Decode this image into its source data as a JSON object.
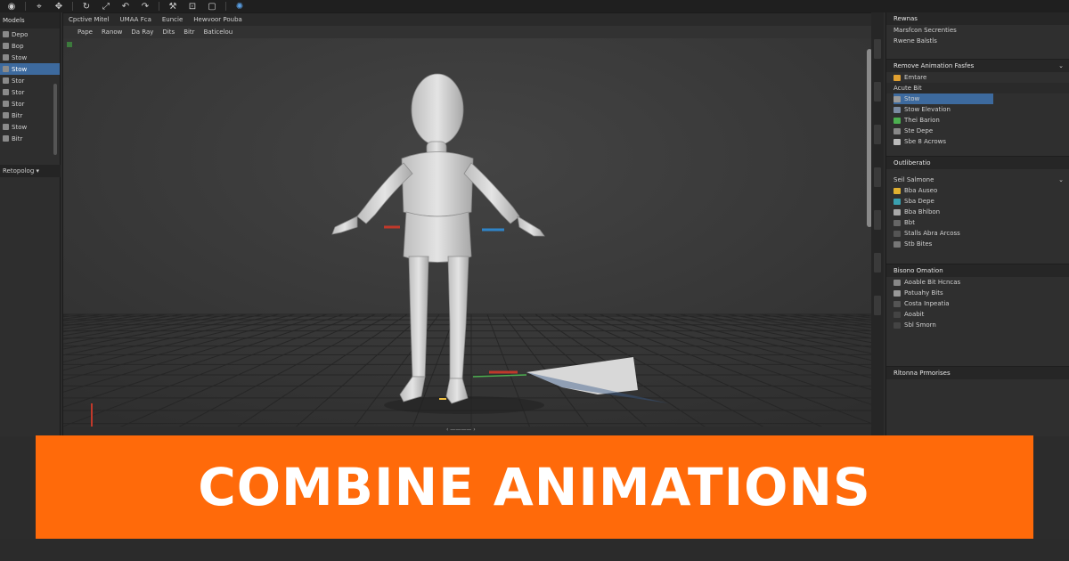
{
  "toolbar": {
    "icons": [
      "viewport-icon",
      "select-icon",
      "move-icon",
      "rotate-icon",
      "scale-icon",
      "undo-icon",
      "redo-icon",
      "transform-icon",
      "snap-icon",
      "frame-icon",
      "globe-icon"
    ]
  },
  "left_panel": {
    "header": "Models",
    "items": [
      {
        "label": "Depo",
        "selected": false
      },
      {
        "label": "Bop",
        "selected": false
      },
      {
        "label": "Stow",
        "selected": false
      },
      {
        "label": "Stow",
        "selected": true
      },
      {
        "label": "Stor",
        "selected": false
      },
      {
        "label": "Stor",
        "selected": false
      },
      {
        "label": "Stor",
        "selected": false
      },
      {
        "label": "Bitr",
        "selected": false
      },
      {
        "label": "Stow",
        "selected": false
      },
      {
        "label": "Bitr",
        "selected": false
      }
    ],
    "footer": "Retopolog ▾"
  },
  "viewport": {
    "menu": [
      "Cpctive Mitel",
      "UMAA Fca",
      "Euncie",
      "Hewvoor Pouba"
    ],
    "submenu": [
      "Pape",
      "Ranow",
      "Da Ray",
      "Dits",
      "Bitr",
      "Baticelou"
    ],
    "bottom_text": "‹ ———— ›"
  },
  "right_panel": {
    "title": "Rewnas",
    "tabs": [
      "Marsfcon Secrenties",
      "Rwene Balstls"
    ],
    "section1": {
      "header": "Remove Animation Fasfes",
      "sub": "Emtare",
      "group": "Acute Bit",
      "items": [
        "Stow",
        "Stow Elevation",
        "Thei Barion",
        "Ste Depe",
        "Sbe 8 Acrows"
      ]
    },
    "section2": {
      "header": "Outliberatio",
      "sub": "Seil Salmone",
      "items": [
        "Bba Auseo",
        "Sba Depe",
        "Bba Bhlbon",
        "Bbt",
        "Stalls Abra Arcoss",
        "Stb Bites"
      ]
    },
    "section3": {
      "header": "Bisono Omation",
      "items": [
        "Aoable Bit Hcncas",
        "Patuahy Bits",
        "Costa Inpeatia",
        "Aoabit",
        "Sbl Smorn"
      ]
    },
    "section4": {
      "header": "Rltonna Prmorises"
    }
  },
  "banner": {
    "title": "COMBINE ANIMATIONS"
  },
  "colors": {
    "banner": "#ff6a0a",
    "selection": "#3d6a9e",
    "viewport_bg": "#3a3a3a"
  }
}
